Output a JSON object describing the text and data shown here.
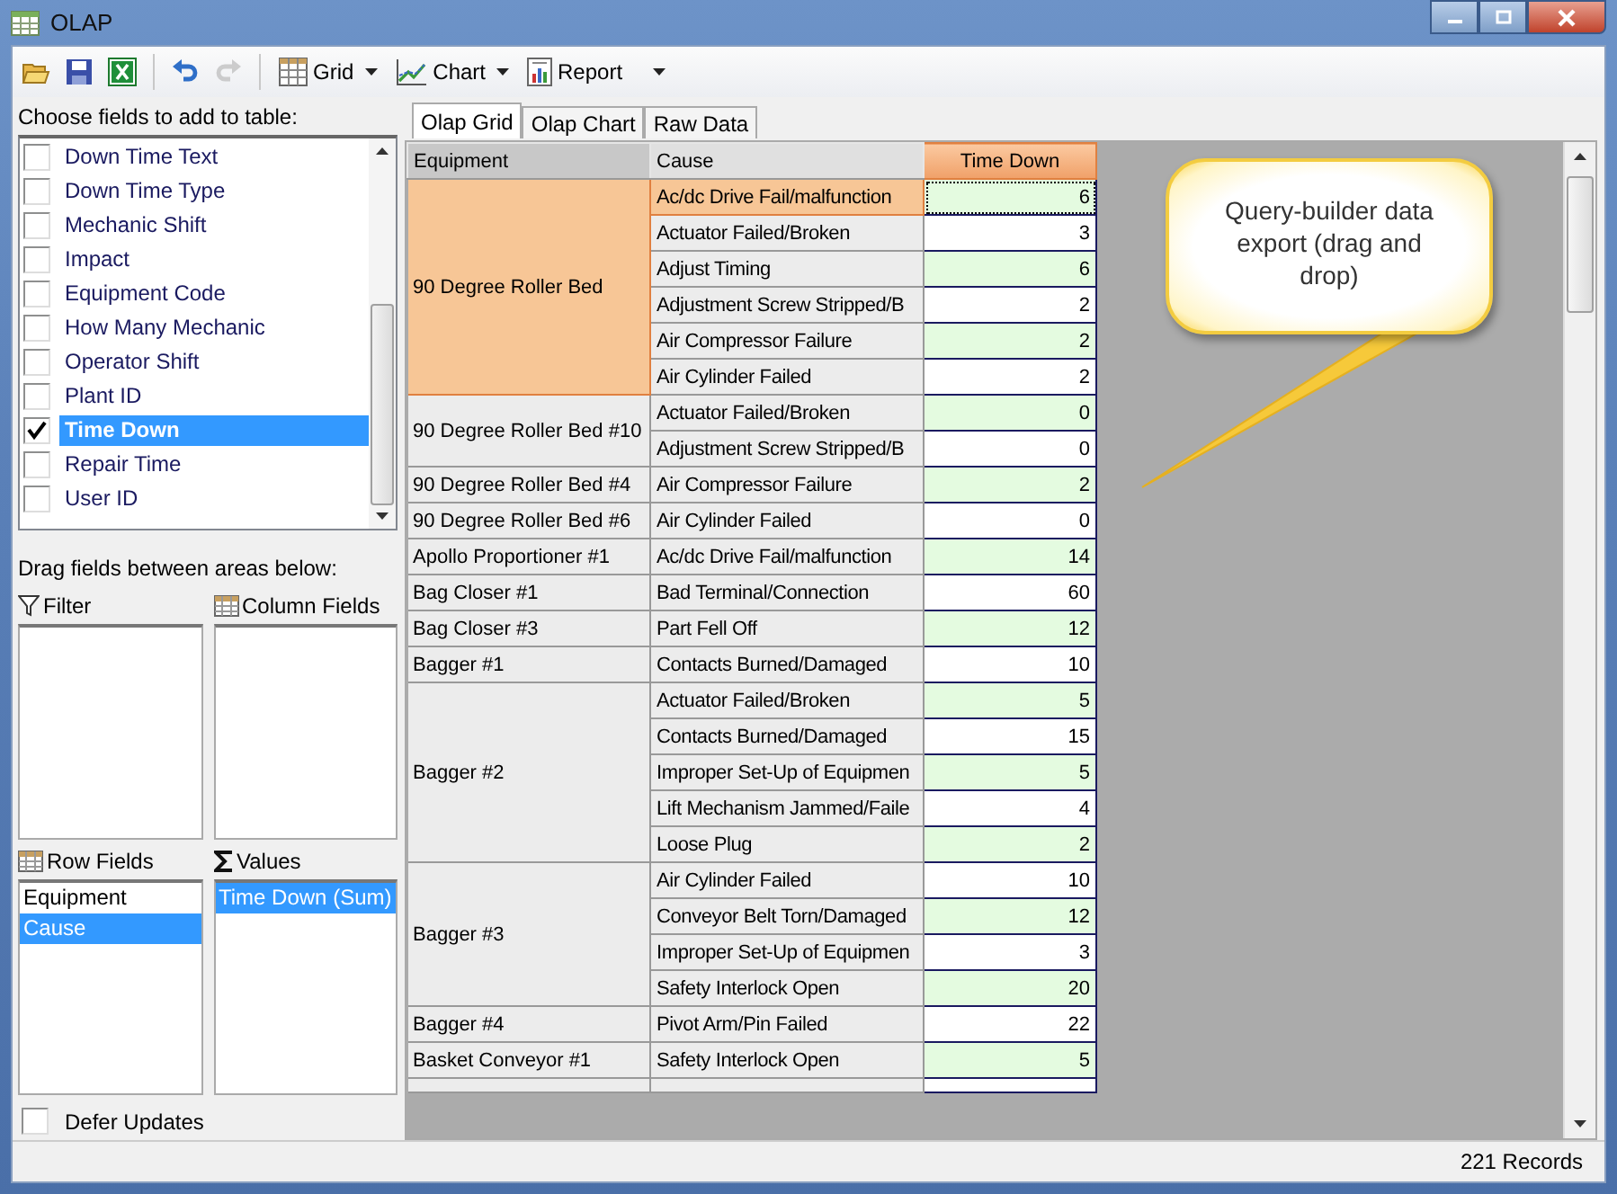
{
  "window": {
    "title": "OLAP"
  },
  "toolbar": {
    "buttons": [
      {
        "kind": "open",
        "disabled": false
      },
      {
        "kind": "save",
        "disabled": false
      },
      {
        "kind": "export",
        "disabled": false
      },
      {
        "kind": "undo",
        "disabled": false
      },
      {
        "kind": "redo",
        "disabled": true
      }
    ],
    "menus": [
      {
        "kind": "grid",
        "label": "Grid"
      },
      {
        "kind": "chart",
        "label": "Chart"
      },
      {
        "kind": "report",
        "label": "Report"
      }
    ]
  },
  "field_list": {
    "label": "Choose fields to add to table:",
    "items": [
      {
        "label": "Down Time Text",
        "checked": false,
        "selected": false
      },
      {
        "label": "Down Time Type",
        "checked": false,
        "selected": false
      },
      {
        "label": "Mechanic Shift",
        "checked": false,
        "selected": false
      },
      {
        "label": "Impact",
        "checked": false,
        "selected": false
      },
      {
        "label": "Equipment Code",
        "checked": false,
        "selected": false
      },
      {
        "label": "How Many Mechanic",
        "checked": false,
        "selected": false
      },
      {
        "label": "Operator Shift",
        "checked": false,
        "selected": false
      },
      {
        "label": "Plant ID",
        "checked": false,
        "selected": false
      },
      {
        "label": "Time Down",
        "checked": true,
        "selected": true
      },
      {
        "label": "Repair Time",
        "checked": false,
        "selected": false
      },
      {
        "label": "User ID",
        "checked": false,
        "selected": false
      }
    ]
  },
  "areas_label": "Drag fields between areas below:",
  "areas": [
    {
      "kind": "filter",
      "label": "Filter"
    },
    {
      "kind": "columns",
      "label": "Column Fields"
    },
    {
      "kind": "rows",
      "label": "Row Fields",
      "items": [
        {
          "label": "Equipment",
          "selected": false
        },
        {
          "label": "Cause",
          "selected": true
        }
      ]
    },
    {
      "kind": "values",
      "label": "Values",
      "items": [
        {
          "label": "Time Down (Sum)",
          "selected": true
        }
      ]
    }
  ],
  "defer_updates": {
    "label": "Defer Updates",
    "checked": false
  },
  "tabs": [
    {
      "label": "Olap Grid",
      "selected": true
    },
    {
      "label": "Olap Chart",
      "selected": false
    },
    {
      "label": "Raw Data",
      "selected": false
    }
  ],
  "grid": {
    "columns": [
      "Equipment",
      "Cause",
      "Time Down"
    ],
    "groups": [
      {
        "equipment": "90 Degree Roller Bed",
        "selected": true,
        "rows": [
          {
            "cause": "Ac/dc Drive Fail/malfunction",
            "value": "6",
            "selected": true
          },
          {
            "cause": "Actuator Failed/Broken",
            "value": "3",
            "selected": false
          },
          {
            "cause": "Adjust Timing",
            "value": "6",
            "selected": false
          },
          {
            "cause": "Adjustment Screw Stripped/B",
            "value": "2",
            "selected": false
          },
          {
            "cause": "Air Compressor Failure",
            "value": "2",
            "selected": false
          },
          {
            "cause": "Air Cylinder Failed",
            "value": "2",
            "selected": false
          }
        ]
      },
      {
        "equipment": "90 Degree Roller Bed #10",
        "selected": false,
        "rows": [
          {
            "cause": "Actuator Failed/Broken",
            "value": "0",
            "selected": false
          },
          {
            "cause": "Adjustment Screw Stripped/B",
            "value": "0",
            "selected": false
          }
        ]
      },
      {
        "equipment": "90 Degree Roller Bed #4",
        "selected": false,
        "rows": [
          {
            "cause": "Air Compressor Failure",
            "value": "2",
            "selected": false
          }
        ]
      },
      {
        "equipment": "90 Degree Roller Bed #6",
        "selected": false,
        "rows": [
          {
            "cause": "Air Cylinder Failed",
            "value": "0",
            "selected": false
          }
        ]
      },
      {
        "equipment": "Apollo Proportioner #1",
        "selected": false,
        "rows": [
          {
            "cause": "Ac/dc Drive Fail/malfunction",
            "value": "14",
            "selected": false
          }
        ]
      },
      {
        "equipment": "Bag Closer #1",
        "selected": false,
        "rows": [
          {
            "cause": "Bad Terminal/Connection",
            "value": "60",
            "selected": false
          }
        ]
      },
      {
        "equipment": "Bag Closer #3",
        "selected": false,
        "rows": [
          {
            "cause": "Part Fell Off",
            "value": "12",
            "selected": false
          }
        ]
      },
      {
        "equipment": "Bagger #1",
        "selected": false,
        "rows": [
          {
            "cause": "Contacts Burned/Damaged",
            "value": "10",
            "selected": false
          }
        ]
      },
      {
        "equipment": "Bagger #2",
        "selected": false,
        "rows": [
          {
            "cause": "Actuator Failed/Broken",
            "value": "5",
            "selected": false
          },
          {
            "cause": "Contacts Burned/Damaged",
            "value": "15",
            "selected": false
          },
          {
            "cause": "Improper Set-Up of Equipmen",
            "value": "5",
            "selected": false
          },
          {
            "cause": "Lift Mechanism Jammed/Faile",
            "value": "4",
            "selected": false
          },
          {
            "cause": "Loose Plug",
            "value": "2",
            "selected": false
          }
        ]
      },
      {
        "equipment": "Bagger #3",
        "selected": false,
        "rows": [
          {
            "cause": "Air Cylinder Failed",
            "value": "10",
            "selected": false
          },
          {
            "cause": "Conveyor Belt Torn/Damaged",
            "value": "12",
            "selected": false
          },
          {
            "cause": "Improper Set-Up of Equipmen",
            "value": "3",
            "selected": false
          },
          {
            "cause": "Safety Interlock Open",
            "value": "20",
            "selected": false
          }
        ]
      },
      {
        "equipment": "Bagger #4",
        "selected": false,
        "rows": [
          {
            "cause": "Pivot Arm/Pin Failed",
            "value": "22",
            "selected": false
          }
        ]
      },
      {
        "equipment": "Basket Conveyor #1",
        "selected": false,
        "rows": [
          {
            "cause": "Safety Interlock Open",
            "value": "5",
            "selected": false
          }
        ]
      }
    ]
  },
  "callout": {
    "text": "Query-builder data export (drag and drop)"
  },
  "status_bar": {
    "records": "221 Records"
  }
}
